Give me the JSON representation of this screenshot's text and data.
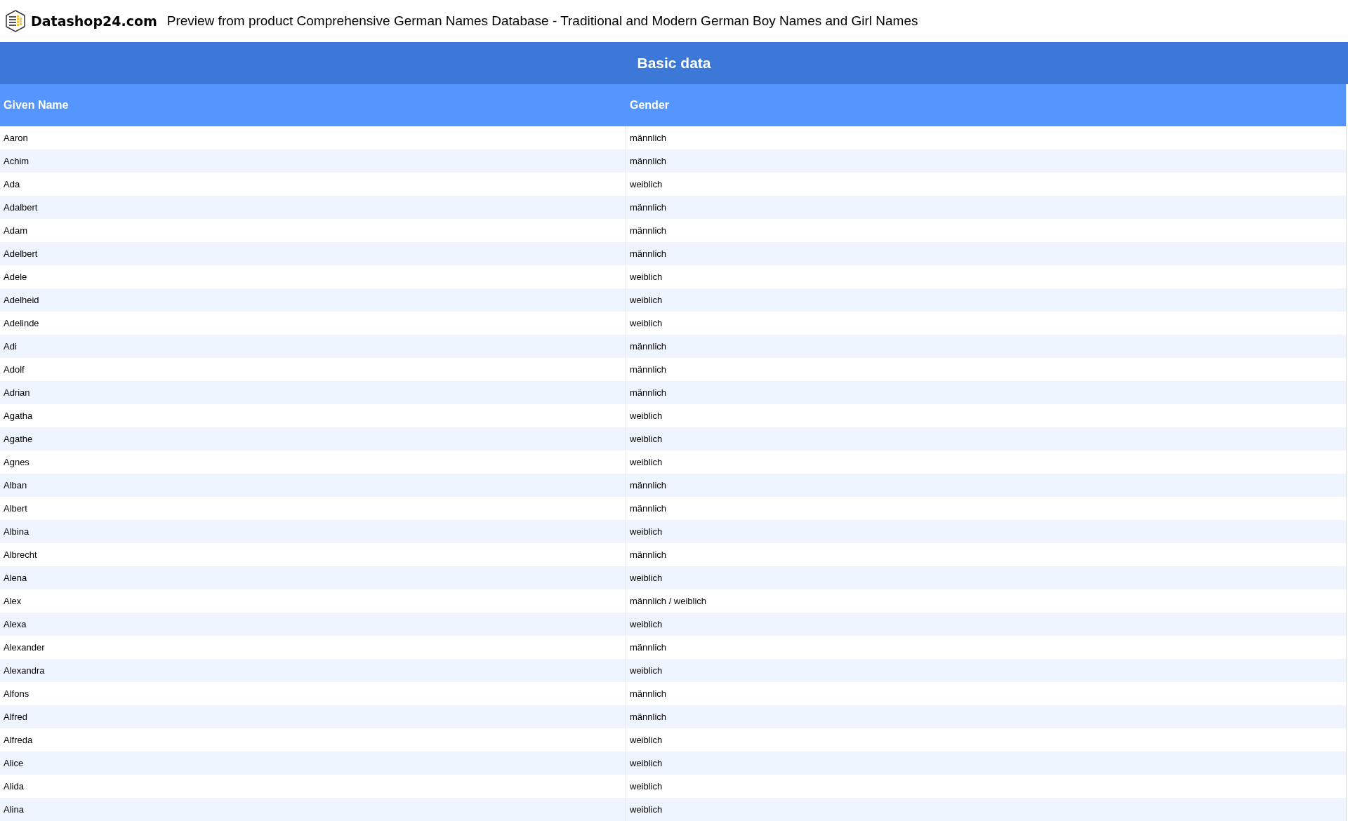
{
  "header": {
    "logo_text": "Datashop24.com",
    "title": "Preview from product Comprehensive German Names Database - Traditional and Modern German Boy Names and Girl Names"
  },
  "table": {
    "caption": "Basic data",
    "columns": [
      "Given Name",
      "Gender"
    ],
    "rows": [
      [
        "Aaron",
        "männlich"
      ],
      [
        "Achim",
        "männlich"
      ],
      [
        "Ada",
        "weiblich"
      ],
      [
        "Adalbert",
        "männlich"
      ],
      [
        "Adam",
        "männlich"
      ],
      [
        "Adelbert",
        "männlich"
      ],
      [
        "Adele",
        "weiblich"
      ],
      [
        "Adelheid",
        "weiblich"
      ],
      [
        "Adelinde",
        "weiblich"
      ],
      [
        "Adi",
        "männlich"
      ],
      [
        "Adolf",
        "männlich"
      ],
      [
        "Adrian",
        "männlich"
      ],
      [
        "Agatha",
        "weiblich"
      ],
      [
        "Agathe",
        "weiblich"
      ],
      [
        "Agnes",
        "weiblich"
      ],
      [
        "Alban",
        "männlich"
      ],
      [
        "Albert",
        "männlich"
      ],
      [
        "Albina",
        "weiblich"
      ],
      [
        "Albrecht",
        "männlich"
      ],
      [
        "Alena",
        "weiblich"
      ],
      [
        "Alex",
        "männlich / weiblich"
      ],
      [
        "Alexa",
        "weiblich"
      ],
      [
        "Alexander",
        "männlich"
      ],
      [
        "Alexandra",
        "weiblich"
      ],
      [
        "Alfons",
        "männlich"
      ],
      [
        "Alfred",
        "männlich"
      ],
      [
        "Alfreda",
        "weiblich"
      ],
      [
        "Alice",
        "weiblich"
      ],
      [
        "Alida",
        "weiblich"
      ],
      [
        "Alina",
        "weiblich"
      ]
    ]
  }
}
